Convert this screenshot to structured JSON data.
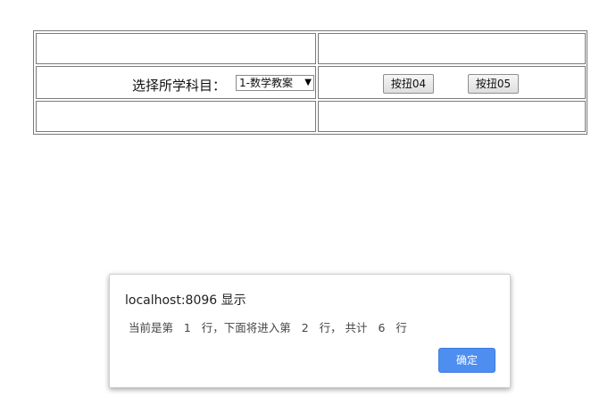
{
  "form": {
    "subject_label": "选择所学科目：",
    "subject_select": {
      "selected": "1-数学教案"
    },
    "buttons": [
      {
        "label": "按扭04"
      },
      {
        "label": "按扭05"
      }
    ]
  },
  "dialog": {
    "title": "localhost:8096 显示",
    "message": "当前是第   1   行，下面将进入第   2   行， 共计   6   行",
    "ok_label": "确定",
    "ok_color": "#4d8ef0"
  }
}
